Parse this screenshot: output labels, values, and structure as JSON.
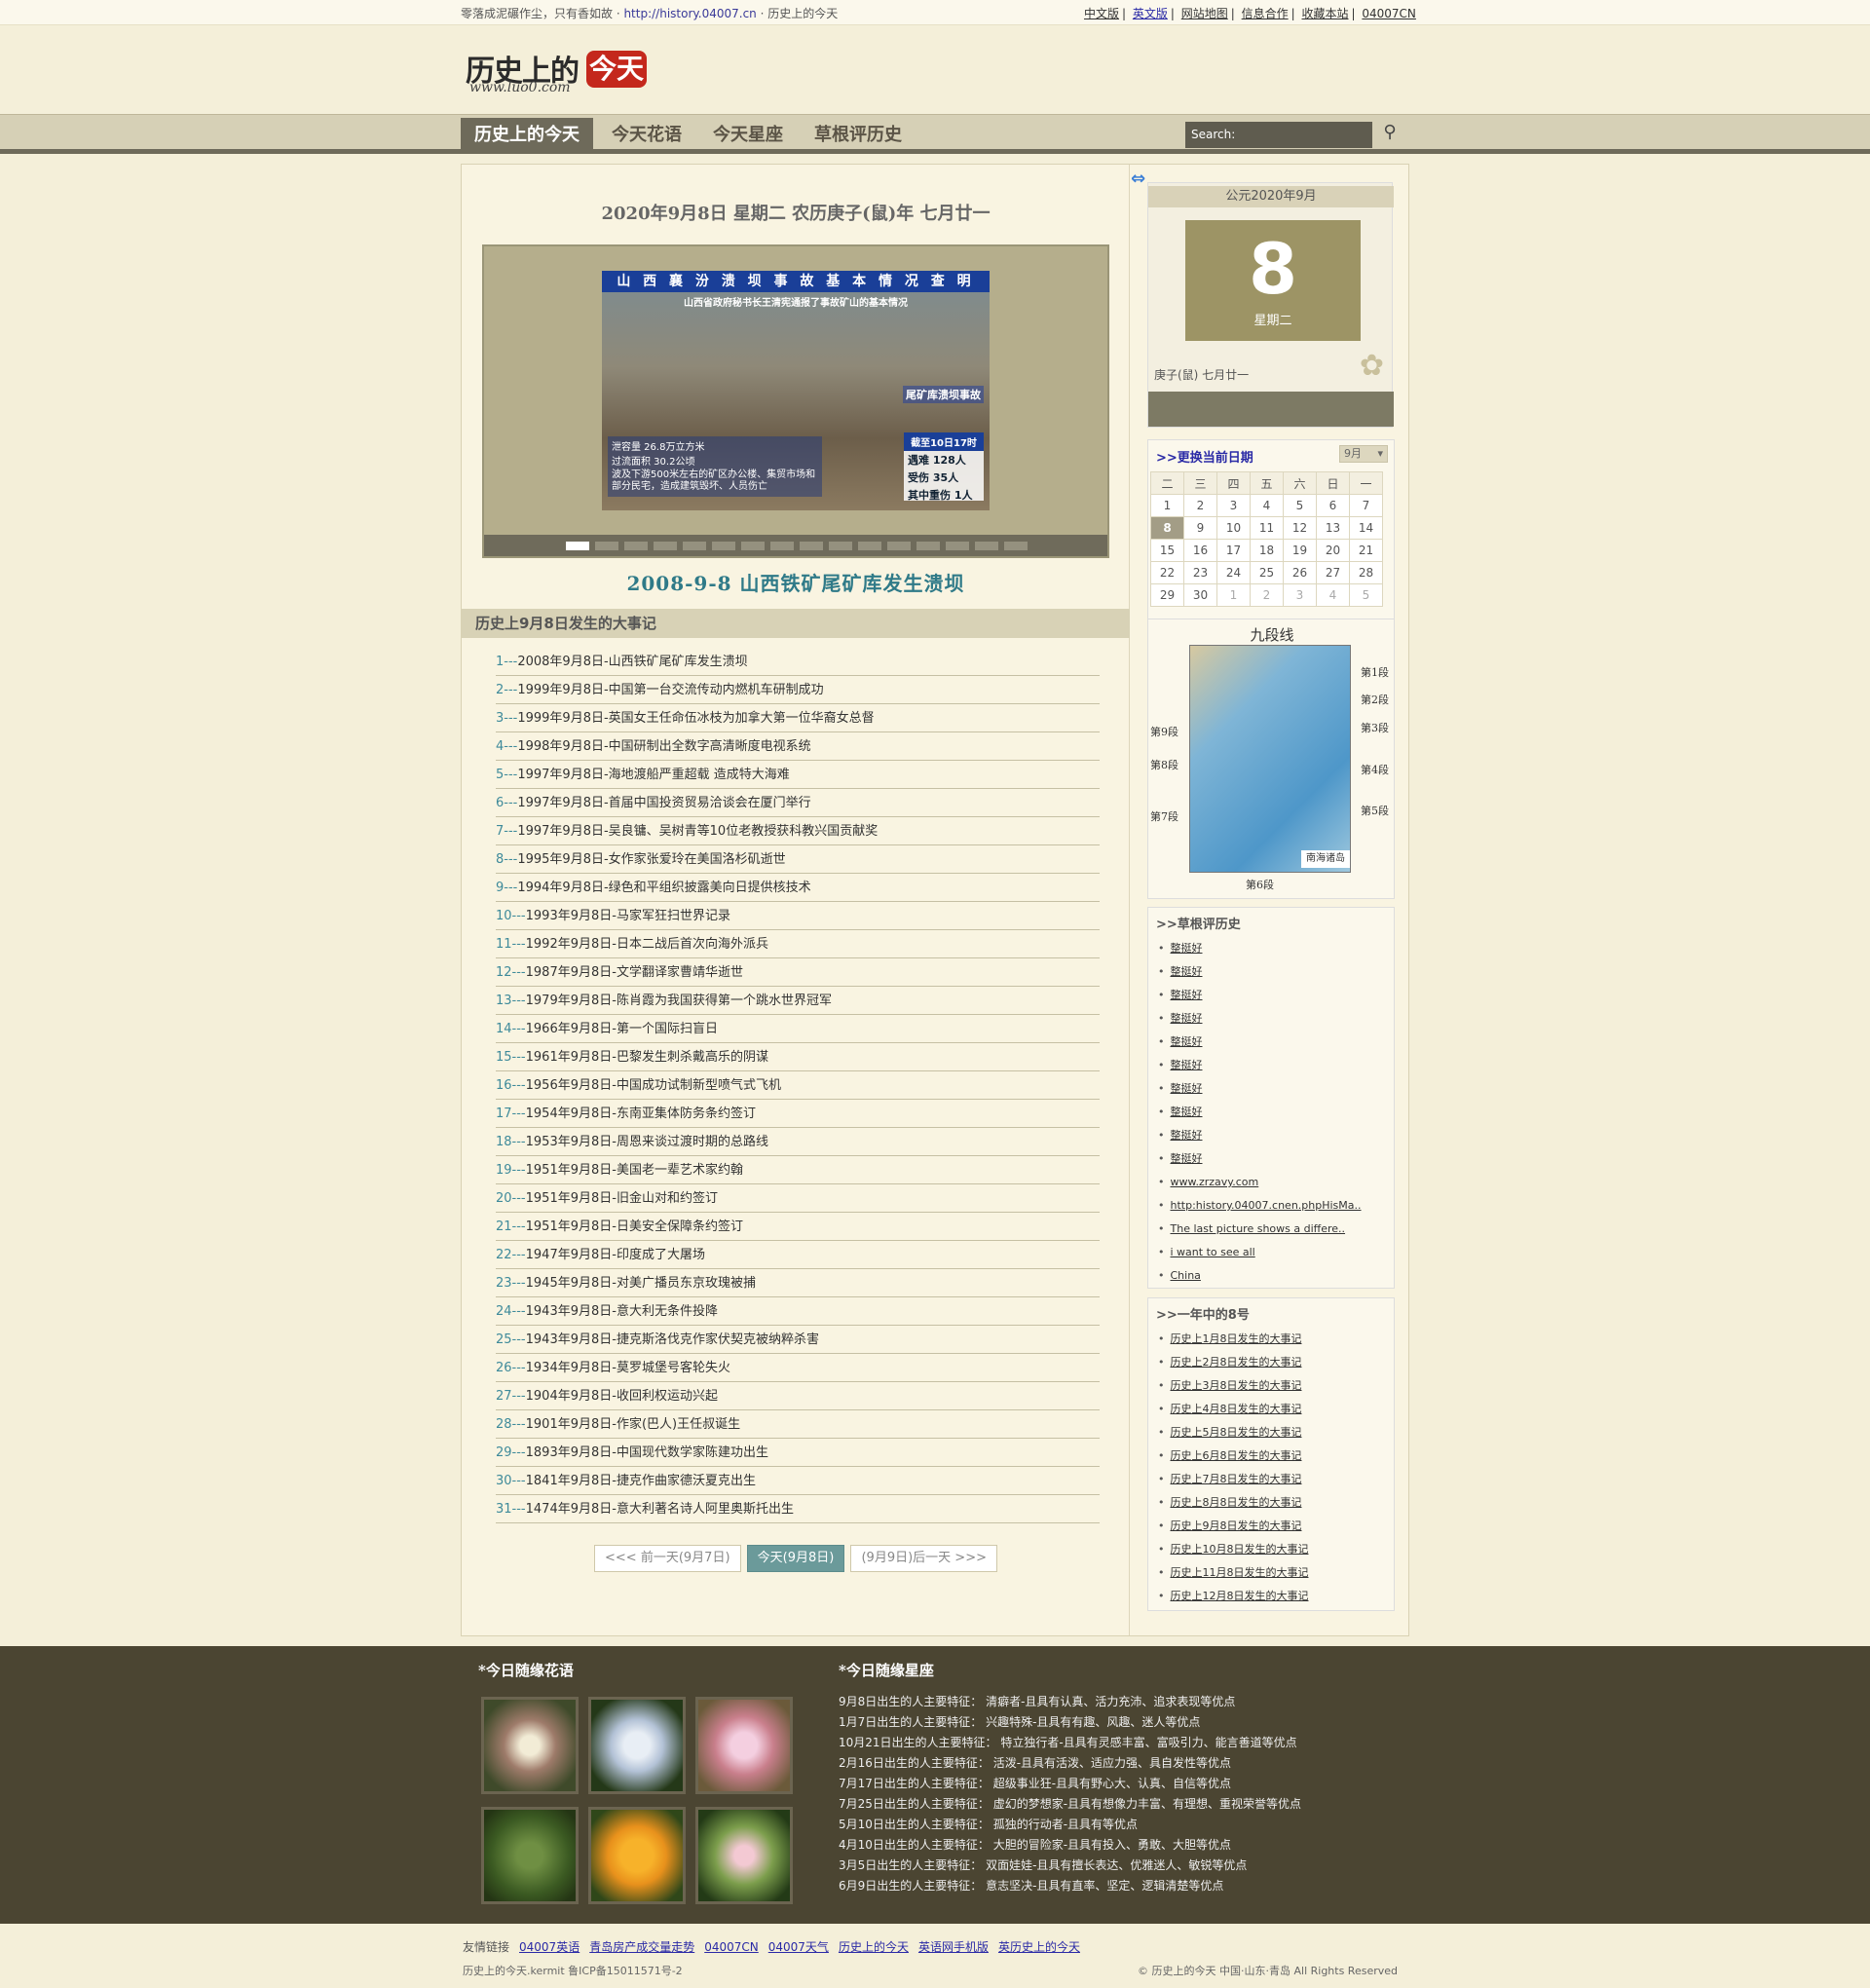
{
  "topbar": {
    "tagline_left": "零落成泥碾作尘，只有香如故 · ",
    "tagline_url": "http://history.04007.cn",
    "tagline_right": " · 历史上的今天",
    "links": [
      "中文版",
      "英文版",
      "网站地图",
      "信息合作",
      "收藏本站",
      "04007CN"
    ]
  },
  "logo": {
    "title": "历史上的",
    "red": "今天",
    "sub": "www.luo0.com"
  },
  "nav": {
    "tabs": [
      "历史上的今天",
      "今天花语",
      "今天星座",
      "草根评历史"
    ],
    "search_placeholder": "Search:"
  },
  "main": {
    "date_heading": "2020年9月8日 星期二 农历庚子(鼠)年 七月廿一",
    "slide": {
      "banner": "山 西 襄 汾 溃 坝 事 故 基 本 情 况 查 明",
      "subtitle": "山西省政府秘书长王清宪通报了事故矿山的基本情况",
      "tag": "尾矿库溃坝事故",
      "info_lines": [
        "泄容量  26.8万立方米",
        "过流面积  30.2公顷",
        "波及下游500米左右的矿区办公楼、集贸市场和部分民宅，造成建筑毁坏、人员伤亡"
      ],
      "stats_header": "截至10日17时",
      "stats": [
        "遇难 128人",
        "受伤 35人",
        "其中重伤 1人"
      ],
      "dot_count": 16,
      "active_dot": 0,
      "caption": "2008-9-8 山西铁矿尾矿库发生溃坝"
    },
    "events_heading": "历史上9月8日发生的大事记",
    "events": [
      "2008年9月8日-山西铁矿尾矿库发生溃坝",
      "1999年9月8日-中国第一台交流传动内燃机车研制成功",
      "1999年9月8日-英国女王任命伍冰枝为加拿大第一位华裔女总督",
      "1998年9月8日-中国研制出全数字高清晰度电视系统",
      "1997年9月8日-海地渡船严重超载 造成特大海难",
      "1997年9月8日-首届中国投资贸易洽谈会在厦门举行",
      "1997年9月8日-吴良镛、吴树青等10位老教授获科教兴国贡献奖",
      "1995年9月8日-女作家张爱玲在美国洛杉矶逝世",
      "1994年9月8日-绿色和平组织披露美向日提供核技术",
      "1993年9月8日-马家军狂扫世界记录",
      "1992年9月8日-日本二战后首次向海外派兵",
      "1987年9月8日-文学翻译家曹靖华逝世",
      "1979年9月8日-陈肖霞为我国获得第一个跳水世界冠军",
      "1966年9月8日-第一个国际扫盲日",
      "1961年9月8日-巴黎发生刺杀戴高乐的阴谋",
      "1956年9月8日-中国成功试制新型喷气式飞机",
      "1954年9月8日-东南亚集体防务条约签订",
      "1953年9月8日-周恩来谈过渡时期的总路线",
      "1951年9月8日-美国老一辈艺术家约翰",
      "1951年9月8日-旧金山对和约签订",
      "1951年9月8日-日美安全保障条约签订",
      "1947年9月8日-印度成了大屠场",
      "1945年9月8日-对美广播员东京玫瑰被捕",
      "1943年9月8日-意大利无条件投降",
      "1943年9月8日-捷克斯洛伐克作家伏契克被纳粹杀害",
      "1934年9月8日-莫罗城堡号客轮失火",
      "1904年9月8日-收回利权运动兴起",
      "1901年9月8日-作家(巴人)王任叔诞生",
      "1893年9月8日-中国现代数学家陈建功出生",
      "1841年9月8日-捷克作曲家德沃夏克出生",
      "1474年9月8日-意大利著名诗人阿里奥斯托出生"
    ],
    "pager": {
      "prev": "<<< 前一天(9月7日)",
      "today": "今天(9月8日)",
      "next": "(9月9日)后一天 >>>"
    }
  },
  "side": {
    "calendar": {
      "year_month": "公元2020年9月",
      "day": "8",
      "weekday": "星期二",
      "lunar": "庚子(鼠) 七月廿一"
    },
    "change": {
      "heading": ">>更换当前日期",
      "month_select": "9月",
      "weekdays": [
        "二",
        "三",
        "四",
        "五",
        "六",
        "日",
        "一"
      ],
      "rows": [
        [
          "1",
          "2",
          "3",
          "4",
          "5",
          "6",
          "7"
        ],
        [
          "8",
          "9",
          "10",
          "11",
          "12",
          "13",
          "14"
        ],
        [
          "15",
          "16",
          "17",
          "18",
          "19",
          "20",
          "21"
        ],
        [
          "22",
          "23",
          "24",
          "25",
          "26",
          "27",
          "28"
        ],
        [
          "29",
          "30",
          "1",
          "2",
          "3",
          "4",
          "5"
        ]
      ]
    },
    "map": {
      "title": "九段线",
      "islands": "南海诸岛",
      "segments": [
        "第1段",
        "第2段",
        "第3段",
        "第4段",
        "第5段",
        "第6段",
        "第7段",
        "第8段",
        "第9段"
      ]
    },
    "grassroots": {
      "heading": ">>草根评历史",
      "items": [
        "整挺好",
        "整挺好",
        "整挺好",
        "整挺好",
        "整挺好",
        "整挺好",
        "整挺好",
        "整挺好",
        "整挺好",
        "整挺好",
        "www.zrzavy.com",
        "http:history.04007.cnen.phpHisMa..",
        "The last picture shows a differe..",
        "i want to see all",
        "China"
      ]
    },
    "eighth": {
      "heading": ">>一年中的8号",
      "items": [
        "历史上1月8日发生的大事记",
        "历史上2月8日发生的大事记",
        "历史上3月8日发生的大事记",
        "历史上4月8日发生的大事记",
        "历史上5月8日发生的大事记",
        "历史上6月8日发生的大事记",
        "历史上7月8日发生的大事记",
        "历史上8月8日发生的大事记",
        "历史上9月8日发生的大事记",
        "历史上10月8日发生的大事记",
        "历史上11月8日发生的大事记",
        "历史上12月8日发生的大事记"
      ]
    }
  },
  "footer": {
    "flowers_heading": "*今日随缘花语",
    "stars_heading": "*今日随缘星座",
    "stars": [
      "9月8日出生的人主要特征： 清癖者-且具有认真、活力充沛、追求表现等优点",
      "1月7日出生的人主要特征： 兴趣特殊-且具有有趣、风趣、迷人等优点",
      "10月21日出生的人主要特征： 特立独行者-且具有灵感丰富、富吸引力、能言善道等优点",
      "2月16日出生的人主要特征： 活泼-且具有活泼、适应力强、具自发性等优点",
      "7月17日出生的人主要特征： 超级事业狂-且具有野心大、认真、自信等优点",
      "7月25日出生的人主要特征： 虚幻的梦想家-且具有想像力丰富、有理想、重视荣誉等优点",
      "5月10日出生的人主要特征： 孤独的行动者-且具有等优点",
      "4月10日出生的人主要特征： 大胆的冒险家-且具有投入、勇敢、大胆等优点",
      "3月5日出生的人主要特征： 双面娃娃-且具有擅长表达、优雅迷人、敏锐等优点",
      "6月9日出生的人主要特征： 意志坚决-且具有直率、坚定、逻辑清楚等优点"
    ],
    "links_label": "友情链接",
    "links": [
      "04007英语",
      "青岛房产成交量走势",
      "04007CN",
      "04007天气",
      "历史上的今天",
      "英语网手机版",
      "英历史上的今天"
    ],
    "icp": "历史上的今天.kermit 鲁ICP备15011571号-2",
    "copyright": "© 历史上的今天 中国·山东·青岛 All Rights Reserved"
  }
}
